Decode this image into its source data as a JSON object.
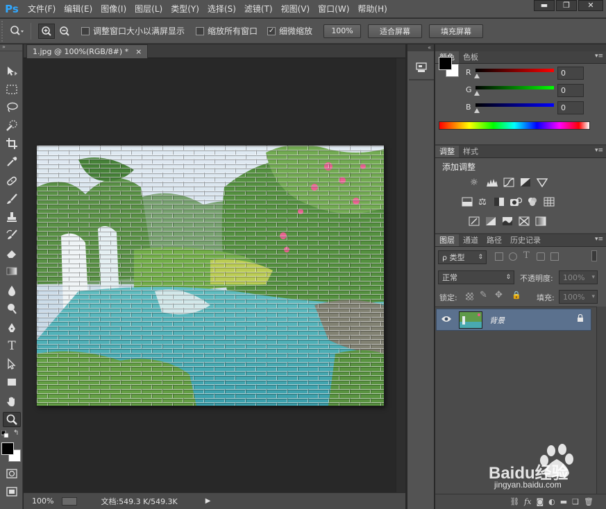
{
  "app": {
    "logo": "Ps"
  },
  "menubar": {
    "items": [
      "文件(F)",
      "编辑(E)",
      "图像(I)",
      "图层(L)",
      "类型(Y)",
      "选择(S)",
      "滤镜(T)",
      "视图(V)",
      "窗口(W)",
      "帮助(H)"
    ],
    "window_controls": [
      "▬",
      "❐",
      "✕"
    ]
  },
  "options": {
    "resize_windows_label": "调整窗口大小以满屏显示",
    "resize_windows_checked": false,
    "zoom_all_label": "缩放所有窗口",
    "zoom_all_checked": false,
    "scrubby_zoom_label": "细微缩放",
    "scrubby_zoom_checked": true,
    "btn_100": "100%",
    "btn_fit": "适合屏幕",
    "btn_fill": "填充屏幕"
  },
  "document": {
    "tab_title": "1.jpg @ 100%(RGB/8#) *",
    "tab_close": "×"
  },
  "status": {
    "zoom": "100%",
    "doc_info": "文档:549.3 K/549.3K"
  },
  "color_panel": {
    "tabs": [
      "颜色",
      "色板"
    ],
    "active_tab": 0,
    "r_label": "R",
    "g_label": "G",
    "b_label": "B",
    "r": "0",
    "g": "0",
    "b": "0",
    "foreground": "#000000",
    "background": "#ffffff"
  },
  "adjust_panel": {
    "tabs": [
      "调整",
      "样式"
    ],
    "active_tab": 0,
    "title": "添加调整"
  },
  "layers_panel": {
    "tabs": [
      "图层",
      "通道",
      "路径",
      "历史记录"
    ],
    "active_tab": 0,
    "filter_kind": "ρ 类型",
    "blend_mode": "正常",
    "opacity_label": "不透明度:",
    "opacity_value": "100%",
    "lock_label": "锁定:",
    "fill_label": "填充:",
    "fill_value": "100%",
    "layers": [
      {
        "name": "背景",
        "visible": true,
        "locked": true
      }
    ]
  },
  "watermark": {
    "text": "Baidu经验",
    "url": "jingyan.baidu.com"
  }
}
